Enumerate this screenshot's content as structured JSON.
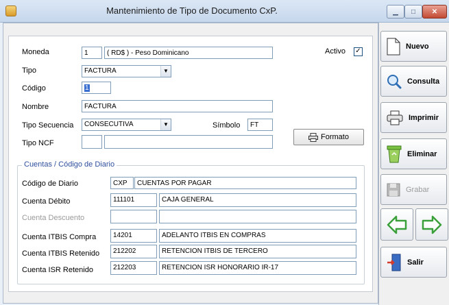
{
  "window": {
    "title": "Mantenimiento de Tipo de Documento CxP."
  },
  "form": {
    "moneda": {
      "label": "Moneda",
      "code": "1",
      "desc": "( RD$ ) - Peso Dominicano"
    },
    "activo": {
      "label": "Activo",
      "checked": true,
      "mark": "✓"
    },
    "tipo": {
      "label": "Tipo",
      "value": "FACTURA"
    },
    "codigo": {
      "label": "Código",
      "value": "1"
    },
    "nombre": {
      "label": "Nombre",
      "value": "FACTURA"
    },
    "tipo_secuencia": {
      "label": "Tipo Secuencia",
      "value": "CONSECUTIVA"
    },
    "simbolo": {
      "label": "Símbolo",
      "value": "FT"
    },
    "tipo_ncf": {
      "label": "Tipo NCF",
      "code": "",
      "desc": ""
    },
    "formato_button": "Formato"
  },
  "cuentas": {
    "title": "Cuentas / Código de Diario",
    "rows": [
      {
        "label": "Código de Diario",
        "code": "CXP",
        "desc": "CUENTAS POR PAGAR",
        "disabled": false
      },
      {
        "label": "Cuenta Débito",
        "code": "111101",
        "desc": "CAJA GENERAL",
        "disabled": false
      },
      {
        "label": "Cuenta Descuento",
        "code": "",
        "desc": "",
        "disabled": true
      },
      {
        "label": "Cuenta ITBIS Compra",
        "code": "14201",
        "desc": "ADELANTO ITBIS EN COMPRAS",
        "disabled": false
      },
      {
        "label": "Cuenta ITBIS Retenido",
        "code": "212202",
        "desc": "RETENCION ITBIS DE TERCERO",
        "disabled": false
      },
      {
        "label": "Cuenta ISR Retenido",
        "code": "212203",
        "desc": "RETENCION ISR HONORARIO IR-17",
        "disabled": false
      }
    ]
  },
  "sidebar": {
    "nuevo": "Nuevo",
    "consulta": "Consulta",
    "imprimir": "Imprimir",
    "eliminar": "Eliminar",
    "grabar": "Grabar",
    "salir": "Salir"
  },
  "colors": {
    "accent": "#2e4e9c",
    "nav_arrow": "#52b947"
  }
}
